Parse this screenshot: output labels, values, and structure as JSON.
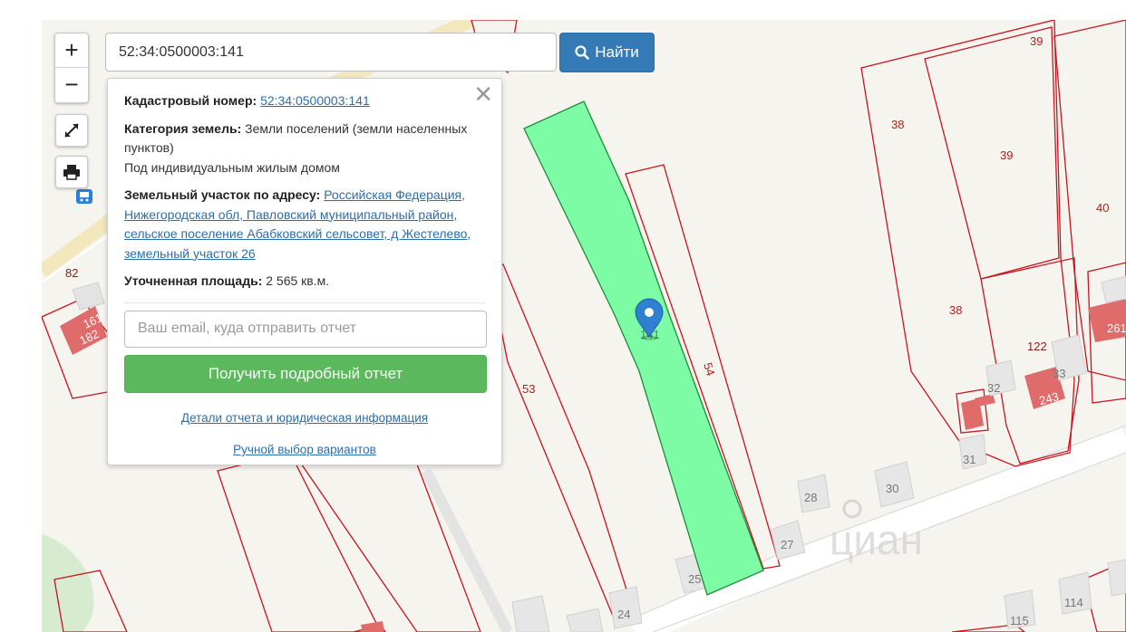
{
  "search": {
    "value": "52:34:0500003:141",
    "button_label": "Найти"
  },
  "zoom": {
    "in_label": "+",
    "out_label": "−"
  },
  "popup": {
    "close_glyph": "✕",
    "cadastral_label": "Кадастровый номер:",
    "cadastral_value": "52:34:0500003:141",
    "category_label": "Категория земель:",
    "category_value": "Земли поселений (земли населенных пунктов)",
    "use_value": "Под индивидуальным жилым домом",
    "address_label": "Земельный участок по адресу:",
    "address_value": "Российская Федерация, Нижегородская обл, Павловский муниципальный район, сельское поселение Абабковский сельсовет, д Жестелево, земельный участок 26",
    "area_label": "Уточненная площадь:",
    "area_value": "2 565 кв.м.",
    "email_placeholder": "Ваш email, куда отправить отчет",
    "report_button": "Получить подробный отчет",
    "details_link": "Детали отчета и юридическая информация",
    "manual_link": "Ручной выбор вариантов"
  },
  "map": {
    "plot_labels": [
      "39",
      "38",
      "39",
      "40",
      "38",
      "122",
      "33",
      "243",
      "32",
      "261",
      "31",
      "82",
      "161",
      "182",
      "53",
      "54",
      "141",
      "28",
      "30",
      "27",
      "25",
      "24",
      "115",
      "114"
    ],
    "watermark": "циан"
  },
  "colors": {
    "selected_plot": "#7dfca5",
    "plot_border": "#c8141e",
    "building": "#e06b6b",
    "primary": "#337ab7",
    "success": "#5cb85c"
  },
  "icons": {
    "search": "search-icon",
    "fullscreen": "expand-icon",
    "print": "printer-icon",
    "close": "close-icon",
    "marker": "map-marker-icon",
    "bus_stop": "bus-stop-icon"
  }
}
